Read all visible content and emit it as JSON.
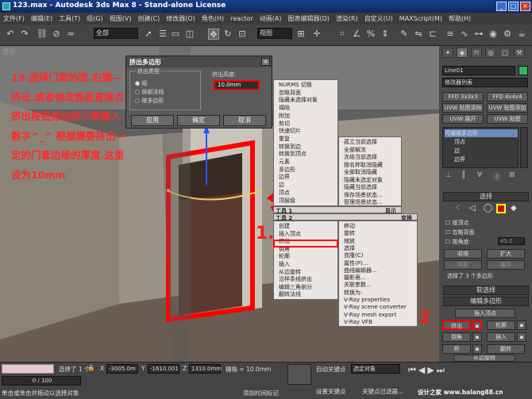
{
  "window": {
    "title": "123.max - Autodesk 3ds Max 8 - Stand-alone License"
  },
  "menubar": [
    "文件(F)",
    "编辑(E)",
    "工具(T)",
    "组(G)",
    "视图(V)",
    "创建(C)",
    "修改器(O)",
    "角色(H)",
    "reactor",
    "动画(A)",
    "图表编辑器(D)",
    "渲染(R)",
    "自定义(U)",
    "MAXScript(M)",
    "帮助(H)"
  ],
  "toolbar": {
    "selection_filter": "全部",
    "view_dropdown": "视图"
  },
  "viewport": {
    "label": "透视"
  },
  "instructions": "19.选择门套的面.右键—挤出.或者修改面板直接点挤出按钮旁边的小框输入数字^_^ 根据需要挤出一定的门套边缘的厚度.这里设为10mm",
  "dialog": {
    "title": "挤出多边形",
    "type_group": "挤出类型",
    "options": [
      "组",
      "局部法线",
      "按多边形"
    ],
    "height_label": "挤出高度:",
    "height_value": "10.0mm",
    "apply": "应用",
    "ok": "确定",
    "cancel": "取消"
  },
  "annotations": {
    "step1": "1.",
    "step2": "2"
  },
  "context_menu": {
    "upper_right": [
      "NURMS 切换",
      "忽略背面",
      "隐藏未选择对象",
      "塌陷",
      "附加",
      "剪切",
      "快速切片",
      "重复",
      "转换到边",
      "转换到顶点",
      "元素",
      "多边形",
      "边界",
      "边",
      "顶点",
      "顶层级"
    ],
    "upper_far": [
      "孤立当前选择",
      "全部解冻",
      "冻结当前选择",
      "按名称取消隐藏",
      "全部取消隐藏",
      "隐藏未选定对象",
      "隐藏当前选择",
      "保存场景状态...",
      "管理场景状态..."
    ],
    "header_left": "工具 1",
    "header_right": "显示",
    "header2_left": "工具 2",
    "header2_right": "变换",
    "lower_left": [
      "创建",
      "插入顶点",
      "挤出",
      "倒角",
      "轮廓",
      "插入",
      "从边旋转",
      "沿样条线挤出",
      "编辑三角剖分",
      "翻转法线"
    ],
    "lower_right": [
      "移动",
      "旋转",
      "缩放",
      "选择",
      "克隆(C)",
      "属性(P)...",
      "曲线编辑器...",
      "摄影表...",
      "关联参数...",
      "转换为:",
      "V-Ray properties",
      "V-Ray scene converter",
      "V-Ray mesh export",
      "V-Ray VFB"
    ]
  },
  "command_panel": {
    "object_name": "Line01",
    "modifier_list": "修改器列表",
    "mod_buttons": [
      "FFD 3x3x3",
      "FFD 4x4x4",
      "UVW 贴图清除",
      "UVW 贴图添加",
      "UVW 展开",
      "UVW 贴图"
    ],
    "stack": [
      "可编辑多边形",
      "顶点",
      "边",
      "边界"
    ],
    "selection_rollout": "选择",
    "by_vertex": "按顶点",
    "ignore_backface": "忽略背面",
    "by_angle": "按角度:",
    "angle_value": "45.0",
    "shrink": "收缩",
    "grow": "扩大",
    "ring": "环形",
    "loop": "循环",
    "selected_count": "选择了 3 个多边形",
    "soft_selection": "软选择",
    "edit_poly": "编辑多边形",
    "insert_vertex": "插入顶点",
    "extrude": "挤出",
    "outline": "轮廓",
    "bevel": "倒角",
    "inset": "插入",
    "bridge": "桥",
    "flip": "翻转",
    "hinge": "从边旋转"
  },
  "status": {
    "timeline": "0 / 100",
    "selected": "选择了 1 个",
    "x_value": "-3005.0m",
    "y_value": "-1610.001",
    "z_value": "1310.0mm",
    "grid": "栅格 = 10.0mm",
    "autokey": "自动关键点",
    "setkey": "设置关键点",
    "selected_obj": "选定对象",
    "key_filter": "关键点过滤器...",
    "prompt": "单击或单击并拖动以选择对象",
    "add_tag": "添加时间标记",
    "watermark": "设计之家 www.balang88.cn"
  },
  "colors": {
    "annotation": "#ff1a1a",
    "highlight_red": "#ff0000"
  }
}
